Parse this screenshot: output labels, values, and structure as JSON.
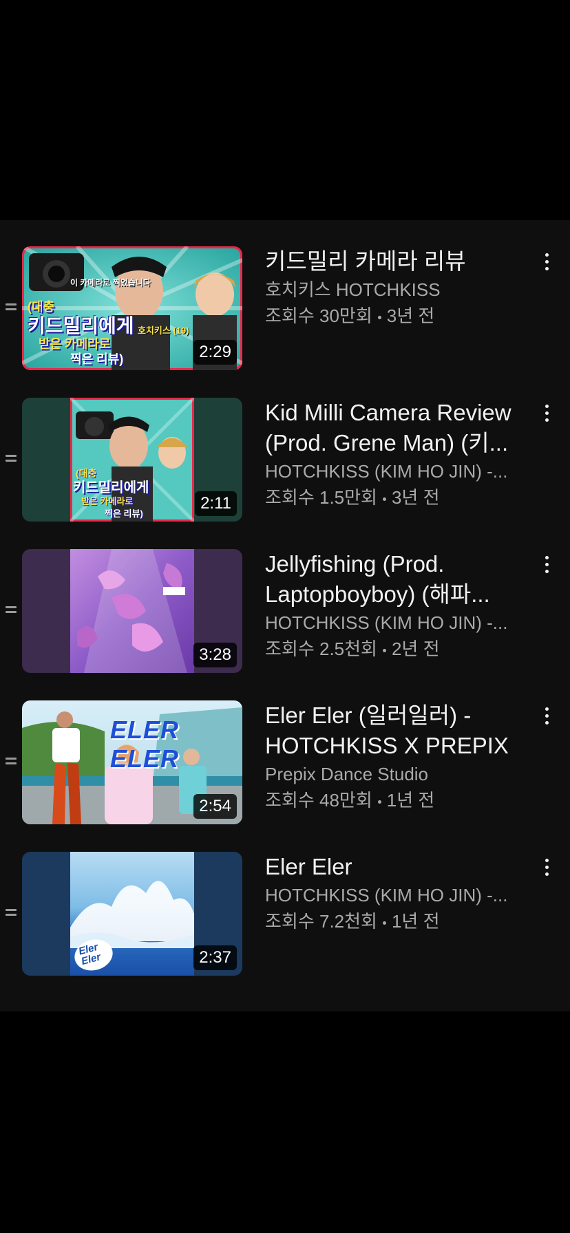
{
  "playlist": {
    "items": [
      {
        "title": "키드밀리 카메라 리뷰",
        "channel": "호치키스 HOTCHKISS",
        "views": "조회수 30만회",
        "age": "3년 전",
        "duration": "2:29"
      },
      {
        "title": "Kid Milli Camera Review (Prod. Grene Man) (키...",
        "channel": "HOTCHKISS (KIM HO JIN) -...",
        "views": "조회수 1.5만회",
        "age": "3년 전",
        "duration": "2:11"
      },
      {
        "title": "Jellyfishing (Prod. Laptopboyboy) (해파...",
        "channel": "HOTCHKISS (KIM HO JIN) -...",
        "views": "조회수 2.5천회",
        "age": "2년 전",
        "duration": "3:28"
      },
      {
        "title": "Eler Eler (일러일러) - HOTCHKISS X PREPIX",
        "channel": "Prepix Dance Studio",
        "views": "조회수 48만회",
        "age": "1년 전",
        "duration": "2:54"
      },
      {
        "title": "Eler Eler",
        "channel": "HOTCHKISS (KIM HO JIN) -...",
        "views": "조회수 7.2천회",
        "age": "1년 전",
        "duration": "2:37"
      }
    ]
  },
  "thumbnail_art": {
    "kidmilli_text_1": "(대충",
    "kidmilli_text_2": "키드밀리에게",
    "kidmilli_text_3": "받은 카메라로",
    "kidmilli_text_4": "찍은 리뷰)",
    "kidmilli_small_1": "이 카메라로 찍었습니다",
    "kidmilli_small_2": "호치키스 (19)",
    "eler_banner": "ELER ELER",
    "eler_logo_1": "Eler",
    "eler_logo_2": "Eler"
  },
  "colors": {
    "panel_bg": "#0f0f0f",
    "text_primary": "#f1f1f1",
    "text_secondary": "#aaaaaa",
    "thumb2_bg": "#1d4038",
    "thumb3_bg": "#3d2c4e",
    "thumb5_bg": "#1b3a5e"
  }
}
